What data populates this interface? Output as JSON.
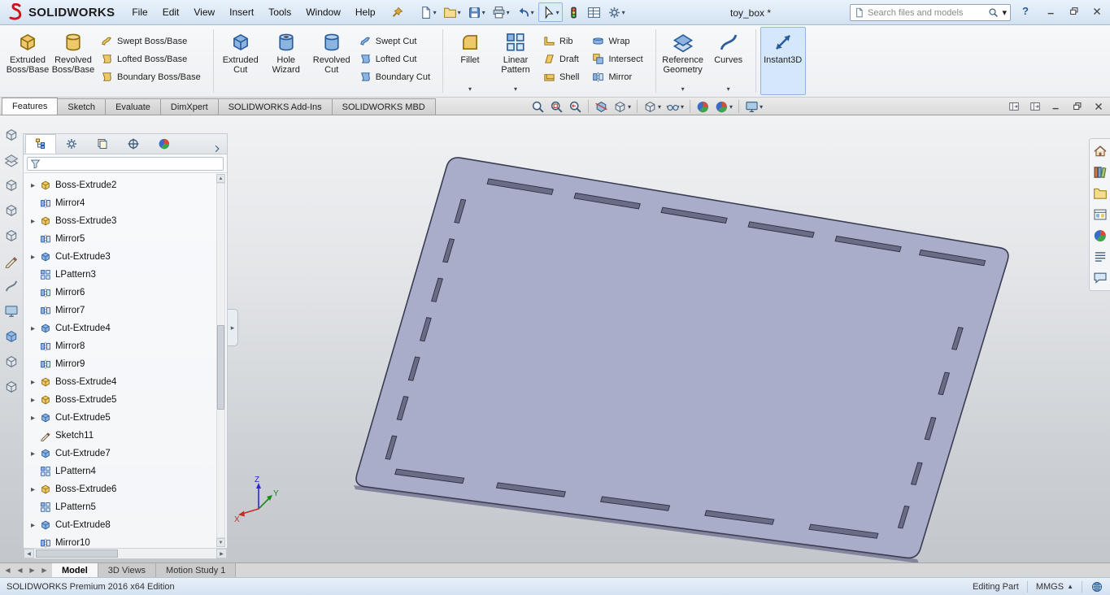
{
  "colors": {
    "part_fill": "#a9adc9",
    "part_edge": "#3a3d52",
    "part_side": "#82859d",
    "slot_fill": "#686c86",
    "slot_edge": "#2e3040",
    "accent": "#2b5d9b",
    "brand_red": "#d1141c"
  },
  "titlebar": {
    "brand": "SOLIDWORKS",
    "menus": [
      "File",
      "Edit",
      "View",
      "Insert",
      "Tools",
      "Window",
      "Help"
    ],
    "document_title": "toy_box *",
    "search_placeholder": "Search files and models",
    "help_label": "?"
  },
  "quick_toolbar": [
    {
      "name": "new-document",
      "icon": "page",
      "dd": true
    },
    {
      "name": "open-document",
      "icon": "folder",
      "dd": true
    },
    {
      "name": "save",
      "icon": "floppy",
      "dd": true
    },
    {
      "name": "print",
      "icon": "printer",
      "dd": true
    },
    {
      "name": "undo",
      "icon": "undo",
      "dd": true
    },
    {
      "name": "select-tool",
      "icon": "cursor",
      "dd": true
    },
    {
      "name": "status-indicator",
      "icon": "traffic",
      "dd": false
    },
    {
      "name": "design-table",
      "icon": "table",
      "dd": false
    },
    {
      "name": "options",
      "icon": "gear",
      "dd": true
    }
  ],
  "ribbon": {
    "groups": [
      {
        "kind": "large",
        "name": "extruded-boss-base",
        "label": "Extruded Boss/Base",
        "icon": "cube_gold"
      },
      {
        "kind": "large",
        "name": "revolved-boss-base",
        "label": "Revolved Boss/Base",
        "icon": "cylinder_gold"
      },
      {
        "kind": "stack",
        "items": [
          {
            "label": "Swept Boss/Base",
            "icon": "boss_swept"
          },
          {
            "label": "Lofted Boss/Base",
            "icon": "boss_loft"
          },
          {
            "label": "Boundary Boss/Base",
            "icon": "boss_loft"
          }
        ]
      },
      {
        "kind": "sep"
      },
      {
        "kind": "large",
        "name": "extruded-cut",
        "label": "Extruded Cut",
        "icon": "cube_blue"
      },
      {
        "kind": "large",
        "name": "hole-wizard",
        "label": "Hole Wizard",
        "icon": "hole_cyl"
      },
      {
        "kind": "large",
        "name": "revolved-cut",
        "label": "Revolved Cut",
        "icon": "cylinder_blue"
      },
      {
        "kind": "stack",
        "items": [
          {
            "label": "Swept Cut",
            "icon": "swept_blue"
          },
          {
            "label": "Lofted Cut",
            "icon": "loft_blue"
          },
          {
            "label": "Boundary Cut",
            "icon": "loft_blue"
          }
        ]
      },
      {
        "kind": "sep"
      },
      {
        "kind": "large",
        "name": "fillet",
        "label": "Fillet",
        "icon": "fillet",
        "dd": true
      },
      {
        "kind": "large",
        "name": "linear-pattern",
        "label": "Linear Pattern",
        "icon": "lpattern",
        "dd": true
      },
      {
        "kind": "stack",
        "items": [
          {
            "label": "Rib",
            "icon": "rib"
          },
          {
            "label": "Draft",
            "icon": "draft"
          },
          {
            "label": "Shell",
            "icon": "shell"
          }
        ]
      },
      {
        "kind": "stack",
        "items": [
          {
            "label": "Wrap",
            "icon": "wrap"
          },
          {
            "label": "Intersect",
            "icon": "intersect"
          },
          {
            "label": "Mirror",
            "icon": "mirror"
          }
        ]
      },
      {
        "kind": "sep"
      },
      {
        "kind": "large",
        "name": "reference-geometry",
        "label": "Reference Geometry",
        "icon": "refgeo",
        "dd": true
      },
      {
        "kind": "large",
        "name": "curves",
        "label": "Curves",
        "icon": "curves",
        "dd": true
      },
      {
        "kind": "sep"
      },
      {
        "kind": "large",
        "name": "instant3d",
        "label": "Instant3D",
        "icon": "instant3d",
        "selected": true
      }
    ]
  },
  "command_tabs": [
    {
      "label": "Features",
      "active": true
    },
    {
      "label": "Sketch"
    },
    {
      "label": "Evaluate"
    },
    {
      "label": "DimXpert"
    },
    {
      "label": "SOLIDWORKS Add-Ins"
    },
    {
      "label": "SOLIDWORKS MBD"
    }
  ],
  "heads_up": [
    {
      "name": "zoom-to-fit",
      "icon": "magnifier"
    },
    {
      "name": "zoom-to-area",
      "icon": "magnifier_area"
    },
    {
      "name": "previous-view",
      "icon": "prev_view"
    },
    {
      "sep": true
    },
    {
      "name": "section-view",
      "icon": "section"
    },
    {
      "name": "view-orientation",
      "icon": "cube_gray",
      "dd": true
    },
    {
      "sep": true
    },
    {
      "name": "display-style",
      "icon": "cube_gray",
      "dd": true
    },
    {
      "name": "hide-show-items",
      "icon": "glasses",
      "dd": true
    },
    {
      "sep": true
    },
    {
      "name": "edit-appearance",
      "icon": "ball"
    },
    {
      "name": "apply-scene",
      "icon": "ball",
      "dd": true
    },
    {
      "sep": true
    },
    {
      "name": "view-settings",
      "icon": "monitor",
      "dd": true
    }
  ],
  "doc_controls": [
    {
      "name": "pane-toggle-left",
      "icon": "pane_icon"
    },
    {
      "name": "pane-toggle-right",
      "icon": "pane_icon"
    },
    {
      "name": "minimize-document",
      "icon": "win_min"
    },
    {
      "name": "restore-document",
      "icon": "win_restore"
    },
    {
      "name": "close-document",
      "icon": "win_close"
    }
  ],
  "window_controls": [
    {
      "name": "minimize-window",
      "icon": "win_min"
    },
    {
      "name": "restore-window",
      "icon": "win_restore"
    },
    {
      "name": "close-window",
      "icon": "win_close"
    }
  ],
  "left_dock": [
    {
      "name": "dock-tool-1",
      "icon": "cube_gray"
    },
    {
      "name": "dock-tool-2",
      "icon": "refgeo_gray"
    },
    {
      "name": "dock-tool-3",
      "icon": "cube_gray"
    },
    {
      "name": "dock-tool-4",
      "icon": "cube_gray"
    },
    {
      "name": "dock-tool-5",
      "icon": "cube_gray"
    },
    {
      "name": "dock-tool-6",
      "icon": "sketch"
    },
    {
      "name": "dock-tool-7",
      "icon": "curves_gray"
    },
    {
      "name": "dock-tool-8",
      "icon": "monitor"
    },
    {
      "name": "dock-tool-9",
      "icon": "cube_blue"
    },
    {
      "name": "dock-tool-10",
      "icon": "cube_gray"
    },
    {
      "name": "dock-tool-11",
      "icon": "cube_gray"
    }
  ],
  "tree": {
    "tabs": [
      {
        "name": "featuremanager-design-tree",
        "icon": "ftree",
        "active": true
      },
      {
        "name": "propertymanager",
        "icon": "gear"
      },
      {
        "name": "configurationmanager",
        "icon": "configmgr"
      },
      {
        "name": "dimxpertmanager",
        "icon": "target"
      },
      {
        "name": "displaymanager",
        "icon": "ball"
      }
    ],
    "items": [
      {
        "label": "Boss-Extrude2",
        "type": "boss",
        "exp": true
      },
      {
        "label": "Mirror4",
        "type": "mirror",
        "exp": false
      },
      {
        "label": "Boss-Extrude3",
        "type": "boss",
        "exp": true
      },
      {
        "label": "Mirror5",
        "type": "mirror",
        "exp": false
      },
      {
        "label": "Cut-Extrude3",
        "type": "cut",
        "exp": true
      },
      {
        "label": "LPattern3",
        "type": "lpattern",
        "exp": false
      },
      {
        "label": "Mirror6",
        "type": "mirror",
        "exp": false
      },
      {
        "label": "Mirror7",
        "type": "mirror",
        "exp": false
      },
      {
        "label": "Cut-Extrude4",
        "type": "cut",
        "exp": true
      },
      {
        "label": "Mirror8",
        "type": "mirror",
        "exp": false
      },
      {
        "label": "Mirror9",
        "type": "mirror",
        "exp": false
      },
      {
        "label": "Boss-Extrude4",
        "type": "boss",
        "exp": true
      },
      {
        "label": "Boss-Extrude5",
        "type": "boss",
        "exp": true
      },
      {
        "label": "Cut-Extrude5",
        "type": "cut",
        "exp": true
      },
      {
        "label": "Sketch11",
        "type": "sketch",
        "exp": false
      },
      {
        "label": "Cut-Extrude7",
        "type": "cut",
        "exp": true
      },
      {
        "label": "LPattern4",
        "type": "lpattern",
        "exp": false
      },
      {
        "label": "Boss-Extrude6",
        "type": "boss",
        "exp": true
      },
      {
        "label": "LPattern5",
        "type": "lpattern",
        "exp": false
      },
      {
        "label": "Cut-Extrude8",
        "type": "cut",
        "exp": true
      },
      {
        "label": "Mirror10",
        "type": "mirror",
        "exp": false
      }
    ]
  },
  "task_pane": [
    {
      "name": "solidworks-resources",
      "icon": "home"
    },
    {
      "name": "design-library",
      "icon": "books"
    },
    {
      "name": "file-explorer",
      "icon": "folder"
    },
    {
      "name": "view-palette",
      "icon": "palette"
    },
    {
      "name": "appearances-scenes",
      "icon": "ball"
    },
    {
      "name": "custom-properties",
      "icon": "list"
    },
    {
      "name": "solidworks-forum",
      "icon": "forum"
    }
  ],
  "model_tabs": [
    {
      "label": "Model",
      "active": true
    },
    {
      "label": "3D Views",
      "active": false
    },
    {
      "label": "Motion Study 1",
      "active": false
    }
  ],
  "statusbar": {
    "left_text": "SOLIDWORKS Premium 2016 x64 Edition",
    "mode": "Editing Part",
    "units": "MMGS"
  },
  "triad": {
    "x": "X",
    "y": "Y",
    "z": "Z"
  }
}
